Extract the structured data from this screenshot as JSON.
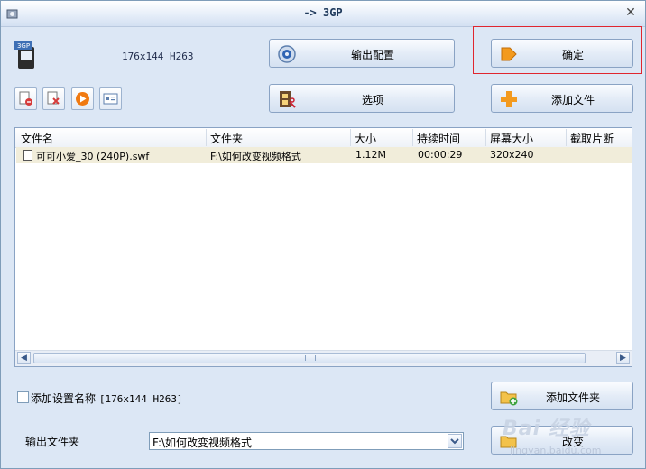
{
  "window": {
    "title": "-> 3GP"
  },
  "format": {
    "icon_text": "3GP",
    "summary": "176x144 H263"
  },
  "buttons": {
    "output_config": "输出配置",
    "ok": "确定",
    "options": "选项",
    "add_file": "添加文件",
    "add_folder": "添加文件夹",
    "change": "改变"
  },
  "small_buttons": [
    "remove-icon",
    "clear-icon",
    "play-icon",
    "info-icon"
  ],
  "file_list": {
    "columns": [
      "文件名",
      "文件夹",
      "大小",
      "持续时间",
      "屏幕大小",
      "截取片断"
    ],
    "rows": [
      {
        "name": "可可小爱_30 (240P).swf",
        "folder": "F:\\如何改变视频格式",
        "size": "1.12M",
        "duration": "00:00:29",
        "screen": "320x240",
        "clip": ""
      }
    ]
  },
  "settings": {
    "add_name_label": "添加设置名称",
    "add_name_value": "[176x144 H263]",
    "checked": false
  },
  "output": {
    "label": "输出文件夹",
    "folder": "F:\\如何改变视频格式"
  },
  "watermark": {
    "brand": "Bai  经验",
    "url": "jingyan.baidu.com"
  },
  "colors": {
    "accent_orange": "#f39a1e",
    "highlight": "#e0262f",
    "row_selected": "#f1edda"
  }
}
